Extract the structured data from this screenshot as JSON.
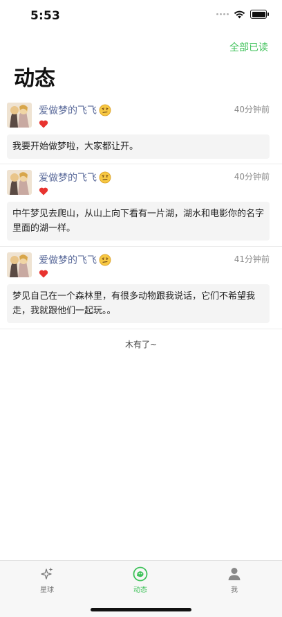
{
  "status_bar": {
    "time": "5:53"
  },
  "header": {
    "mark_all_read": "全部已读",
    "title": "动态"
  },
  "feed": [
    {
      "user": "爱做梦的飞飞",
      "time": "40分钟前",
      "content": "我要开始做梦啦，大家都让开。"
    },
    {
      "user": "爱做梦的飞飞",
      "time": "40分钟前",
      "content": "中午梦见去爬山，从山上向下看有一片湖，湖水和电影你的名字里面的湖一样。"
    },
    {
      "user": "爱做梦的飞飞",
      "time": "41分钟前",
      "content": "梦见自己在一个森林里，有很多动物跟我说话，它们不希望我走，我就跟他们一起玩。。"
    }
  ],
  "end_text": "木有了~",
  "tabs": [
    {
      "label": "星球",
      "icon": "sparkle-icon"
    },
    {
      "label": "动态",
      "icon": "chat-bubble-icon",
      "active": true
    },
    {
      "label": "我",
      "icon": "person-icon"
    }
  ],
  "colors": {
    "accent": "#3fc25a",
    "username": "#5a6a9a",
    "heart": "#e8332f"
  }
}
